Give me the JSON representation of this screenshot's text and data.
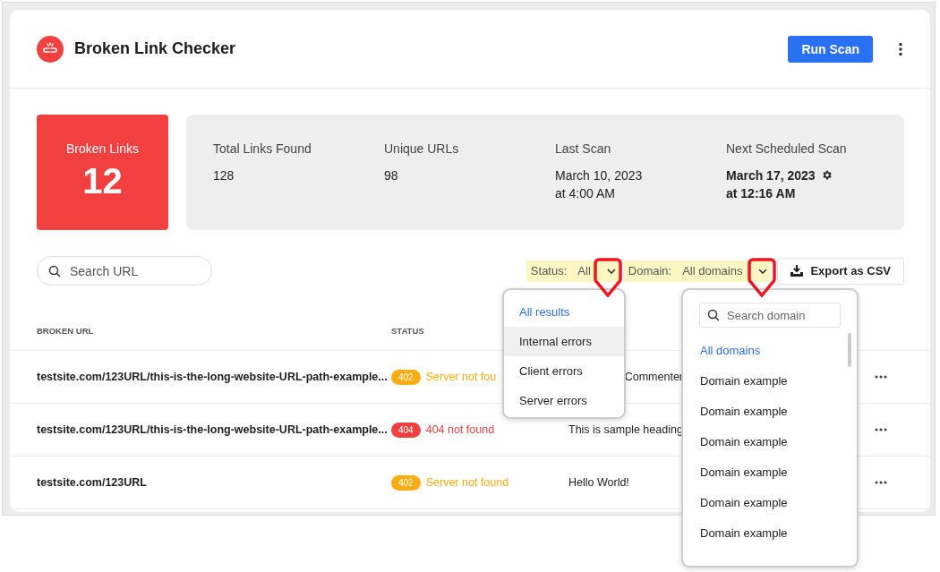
{
  "header": {
    "title": "Broken Link Checker",
    "primary_button": "Run Scan"
  },
  "summary": {
    "label": "Broken Links",
    "count": "12"
  },
  "stats": [
    {
      "label": "Total Links Found",
      "value": "128",
      "settings": false
    },
    {
      "label": "Unique URLs",
      "value": "98",
      "settings": false
    },
    {
      "label": "Last Scan",
      "value": "March 10, 2023\nat 4:00 AM",
      "settings": false
    },
    {
      "label": "Next Scheduled Scan",
      "value": "March 17, 2023\nat 12:16 AM",
      "settings": true
    }
  ],
  "search": {
    "placeholder": "Search URL"
  },
  "filters": [
    {
      "label": "Status:",
      "value": "All"
    },
    {
      "label": "Domain:",
      "value": "All domains"
    }
  ],
  "export_button": "Export as CSV",
  "table": {
    "columns": [
      "BROKEN URL",
      "STATUS"
    ],
    "rows": [
      {
        "url": "testsite.com/123URL/this-is-the-long-website-URL-path-example...",
        "code": "402",
        "status": "Server not fou",
        "color": "#fdad12",
        "column_3": {
          "text": "Commenter",
          "left_hidden": true
        }
      },
      {
        "url": "testsite.com/123URL/this-is-the-long-website-URL-path-example...",
        "code": "404",
        "status": "404 not found",
        "color": "#f24040",
        "column_3": {
          "text": "This is sample heading",
          "left_hidden": false
        }
      },
      {
        "url": "testsite.com/123URL",
        "code": "402",
        "status": "Server not found",
        "color": "#fdad12",
        "column_3": {
          "text": "Hello World!",
          "left_hidden": false
        }
      }
    ]
  },
  "status_menu": {
    "items": [
      {
        "label": "All results",
        "selected": true,
        "hovered": false
      },
      {
        "label": "Internal errors",
        "selected": false,
        "hovered": true
      },
      {
        "label": "Client errors",
        "selected": false,
        "hovered": false
      },
      {
        "label": "Server errors",
        "selected": false,
        "hovered": false
      }
    ]
  },
  "domain_menu": {
    "search_placeholder": "Search domain",
    "items": [
      {
        "label": "All domains",
        "selected": true
      },
      {
        "label": "Domain example",
        "selected": false
      },
      {
        "label": "Domain example",
        "selected": false
      },
      {
        "label": "Domain example",
        "selected": false
      },
      {
        "label": "Domain example",
        "selected": false
      },
      {
        "label": "Domain example",
        "selected": false
      },
      {
        "label": "Domain example",
        "selected": false
      }
    ]
  }
}
